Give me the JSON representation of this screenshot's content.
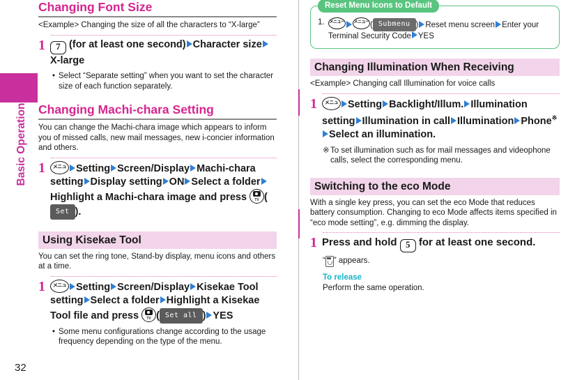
{
  "sidebar": {
    "chapter_label": "Basic Operation",
    "page_number": "32",
    "tab_color": "#c9309e"
  },
  "left_column": {
    "section1": {
      "heading": "Changing Font Size",
      "example": "<Example> Changing the size of all the characters to “X-large”",
      "step_number": "1",
      "step_parts": {
        "key": "7",
        "t1": "(for at least one second)",
        "t2": "Character size",
        "t3": "X-large"
      },
      "bullet": "Select “Separate setting” when you want to set the character size of each function separately."
    },
    "section2": {
      "heading": "Changing Machi-chara Setting",
      "body": "You can change the Machi-chara image which appears to inform you of missed calls, new mail messages, new i-concier information and others.",
      "step_number": "1",
      "step_parts": {
        "menu_key": "メニュー",
        "t1": "Setting",
        "t2": "Screen/Display",
        "t3": "Machi-chara setting",
        "t4": "Display setting",
        "t5": "ON",
        "t6": "Select a folder",
        "t7": "Highlight a Machi-chara image and press",
        "softkey": "Set",
        "tail": ")."
      }
    },
    "section3": {
      "heading": "Using Kisekae Tool",
      "body": "You can set the ring tone, Stand-by display, menu icons and others at a time.",
      "step_number": "1",
      "step_parts": {
        "menu_key": "メニュー",
        "t1": "Setting",
        "t2": "Screen/Display",
        "t3": "Kisekae Tool setting",
        "t4": "Select a folder",
        "t5": "Highlight a Kisekae Tool file and press",
        "softkey": "Set all",
        "t6": "YES"
      },
      "bullet": "Some menu configurations change according to the usage frequency depending on the type of the menu."
    }
  },
  "right_column": {
    "callout": {
      "tab_label": "Reset Menu Icons to Default",
      "item_number": "1.",
      "menu_key": "メニュー",
      "softkey": "Submenu",
      "t1": "Reset menu screen",
      "t2": "Enter your Terminal Security Code",
      "t3": "YES",
      "tab_color": "#59c47f"
    },
    "section1": {
      "heading": "Changing Illumination When Receiving",
      "example": "<Example> Changing call Illumination for voice calls",
      "step_number": "1",
      "step_parts": {
        "menu_key": "メニュー",
        "t1": "Setting",
        "t2": "Backlight/Illum.",
        "t3": "Illumination setting",
        "t4": "Illumination in call",
        "t5": "Illumination",
        "t6": "Phone",
        "mark": "※",
        "t7": "Select an illumination."
      },
      "note_mark": "※",
      "note": "To set illumination such as for mail messages and videophone calls, select the corresponding menu."
    },
    "section2": {
      "heading": "Switching to the eco Mode",
      "body": "With a single key press, you can set the eco Mode that reduces battery consumption. Changing to eco Mode affects items specified in “eco mode setting”, e.g. dimming the display.",
      "step_number": "1",
      "step_parts": {
        "pre": "Press and hold",
        "key": "5",
        "post": "for at least one second."
      },
      "appears_pre": "“",
      "appears_post": "” appears.",
      "release_title": "To release",
      "release_body": "Perform the same operation."
    }
  },
  "colors": {
    "magenta": "#d4268f",
    "pink_band": "#f2d5ea",
    "arrow_blue": "#2f7fd4",
    "green": "#59c47f",
    "teal": "#18b4c8"
  }
}
